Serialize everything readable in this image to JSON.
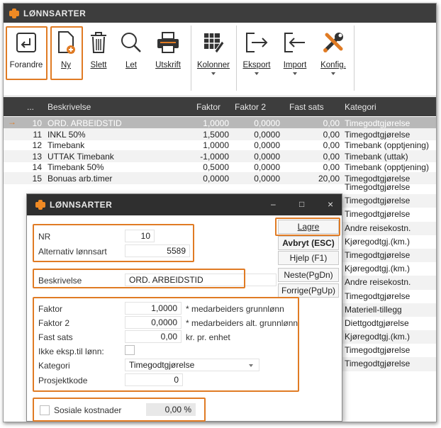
{
  "app": {
    "title": "LØNNSARTER"
  },
  "toolbar": {
    "buttons": [
      {
        "label": "Forandre",
        "icon": "edit-icon"
      },
      {
        "label": "Ny",
        "icon": "new-document-icon"
      },
      {
        "label": "Slett",
        "icon": "trash-icon"
      },
      {
        "label": "Let",
        "icon": "search-icon"
      },
      {
        "label": "Utskrift",
        "icon": "printer-icon"
      },
      {
        "label": "Kolonner",
        "icon": "columns-icon"
      },
      {
        "label": "Eksport",
        "icon": "export-icon"
      },
      {
        "label": "Import",
        "icon": "import-icon"
      },
      {
        "label": "Konfig.",
        "icon": "tools-icon"
      }
    ]
  },
  "grid": {
    "columns": [
      "...",
      "Beskrivelse",
      "Faktor",
      "Faktor 2",
      "Fast sats",
      "Kategori"
    ],
    "rows": [
      {
        "nr": "10",
        "beskrivelse": "ORD. ARBEIDSTID",
        "faktor": "1,0000",
        "faktor2": "0,0000",
        "fast_sats": "0,00",
        "kategori": "Timegodtgjørelse"
      },
      {
        "nr": "11",
        "beskrivelse": "INKL 50%",
        "faktor": "1,5000",
        "faktor2": "0,0000",
        "fast_sats": "0,00",
        "kategori": "Timegodtgjørelse"
      },
      {
        "nr": "12",
        "beskrivelse": "Timebank",
        "faktor": "1,0000",
        "faktor2": "0,0000",
        "fast_sats": "0,00",
        "kategori": "Timebank (opptjening)"
      },
      {
        "nr": "13",
        "beskrivelse": "UTTAK Timebank",
        "faktor": "-1,0000",
        "faktor2": "0,0000",
        "fast_sats": "0,00",
        "kategori": "Timebank (uttak)"
      },
      {
        "nr": "14",
        "beskrivelse": "Timebank 50%",
        "faktor": "0,5000",
        "faktor2": "0,0000",
        "fast_sats": "0,00",
        "kategori": "Timebank (opptjening)"
      },
      {
        "nr": "15",
        "beskrivelse": "Bonuas arb.timer",
        "faktor": "0,0000",
        "faktor2": "0,0000",
        "fast_sats": "20,00",
        "kategori": "Timegodtgjørelse"
      }
    ],
    "more_categories": [
      "Timegodtgjørelse",
      "Timegodtgjørelse",
      "Timegodtgjørelse",
      "Andre reisekostn.",
      "Kjøregodtgj.(km.)",
      "Timegodtgjørelse",
      "Kjøregodtgj.(km.)",
      "Andre reisekostn.",
      "Timegodtgjørelse",
      "Materiell-tillegg",
      "Diettgodtgjørelse",
      "Kjøregodtgj.(km.)",
      "Timegodtgjørelse",
      "Timegodtgjørelse"
    ]
  },
  "dialog": {
    "title": "LØNNSARTER",
    "controls": {
      "minimize": "–",
      "maximize": "□",
      "close": "×"
    },
    "fields": {
      "nr_label": "NR",
      "nr_value": "10",
      "alt_label": "Alternativ lønnsart",
      "alt_value": "5589",
      "beskrivelse_label": "Beskrivelse",
      "beskrivelse_value": "ORD. ARBEIDSTID",
      "faktor_label": "Faktor",
      "faktor_value": "1,0000",
      "faktor_note": "* medarbeiders grunnlønn",
      "faktor2_label": "Faktor 2",
      "faktor2_value": "0,0000",
      "faktor2_note": "* medarbeiders alt. grunnlønn",
      "fast_sats_label": "Fast sats",
      "fast_sats_value": "0,00",
      "fast_sats_note": "kr. pr. enhet",
      "ikke_eksp_label": "Ikke eksp.til lønn:",
      "kategori_label": "Kategori",
      "kategori_value": "Timegodtgjørelse",
      "prosjekt_label": "Prosjektkode",
      "prosjekt_value": "0",
      "sosiale_label": "Sosiale kostnader",
      "sosiale_value": "0,00 %"
    },
    "buttons": {
      "lagre": "Lagre",
      "avbryt": "Avbryt (ESC)",
      "hjelp": "Hjelp (F1)",
      "neste": "Neste(PgDn)",
      "forrige": "Forrige(PgUp)"
    }
  },
  "colors": {
    "accent": "#e07b24",
    "titlebar": "#3d3d3d",
    "selected_row": "#b8b8b8"
  }
}
